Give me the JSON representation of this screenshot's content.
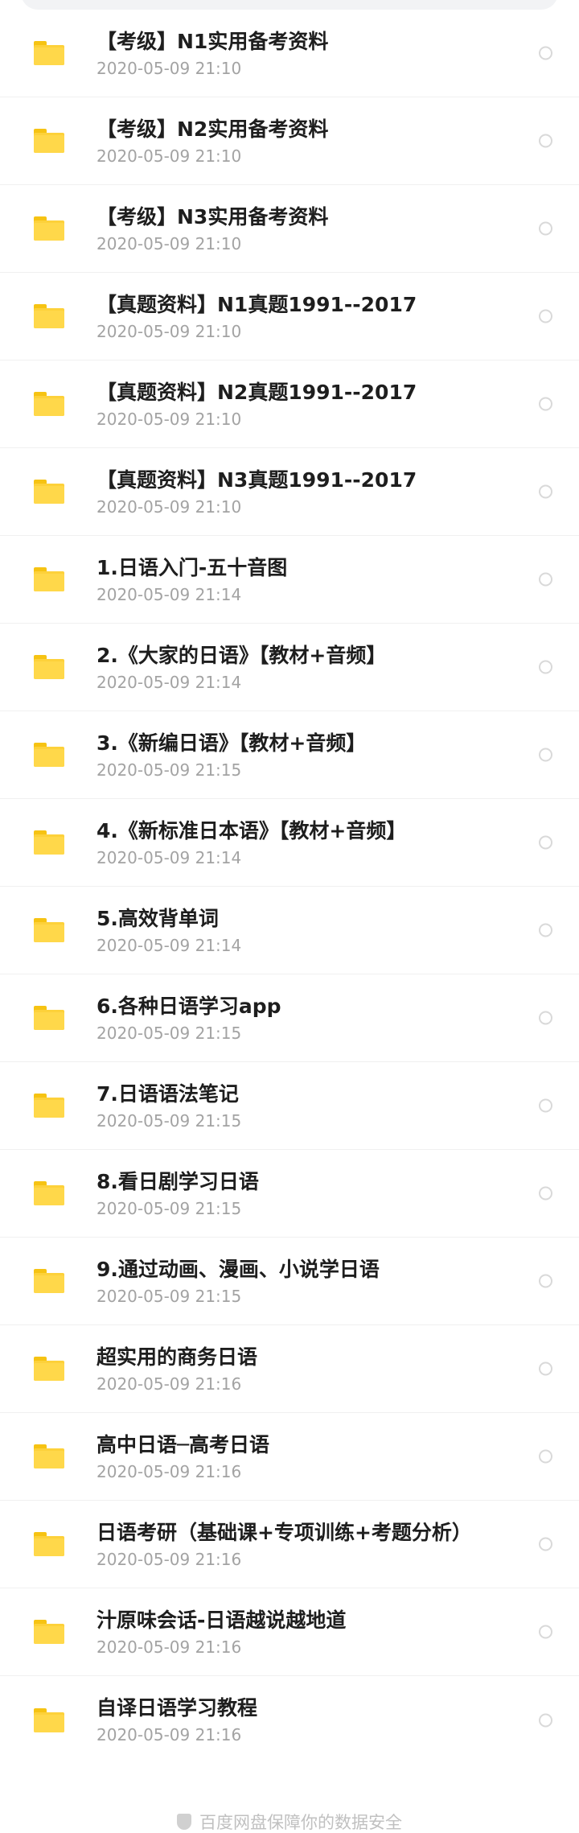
{
  "files": [
    {
      "name": "【考级】N1实用备考资料",
      "date": "2020-05-09  21:10"
    },
    {
      "name": "【考级】N2实用备考资料",
      "date": "2020-05-09  21:10"
    },
    {
      "name": "【考级】N3实用备考资料",
      "date": "2020-05-09  21:10"
    },
    {
      "name": "【真题资料】N1真题1991--2017",
      "date": "2020-05-09  21:10"
    },
    {
      "name": "【真题资料】N2真题1991--2017",
      "date": "2020-05-09  21:10"
    },
    {
      "name": "【真题资料】N3真题1991--2017",
      "date": "2020-05-09  21:10"
    },
    {
      "name": "1.日语入门-五十音图",
      "date": "2020-05-09  21:14"
    },
    {
      "name": "2.《大家的日语》【教材+音频】",
      "date": "2020-05-09  21:14"
    },
    {
      "name": "3.《新编日语》【教材+音频】",
      "date": "2020-05-09  21:15"
    },
    {
      "name": "4.《新标准日本语》【教材+音频】",
      "date": "2020-05-09  21:14"
    },
    {
      "name": "5.高效背单词",
      "date": "2020-05-09  21:14"
    },
    {
      "name": "6.各种日语学习app",
      "date": "2020-05-09  21:15"
    },
    {
      "name": "7.日语语法笔记",
      "date": "2020-05-09  21:15"
    },
    {
      "name": "8.看日剧学习日语",
      "date": "2020-05-09  21:15"
    },
    {
      "name": "9.通过动画、漫画、小说学日语",
      "date": "2020-05-09  21:15"
    },
    {
      "name": "超实用的商务日语",
      "date": "2020-05-09  21:16"
    },
    {
      "name": "高中日语─高考日语",
      "date": "2020-05-09  21:16"
    },
    {
      "name": "日语考研（基础课+专项训练+考题分析）",
      "date": "2020-05-09  21:16"
    },
    {
      "name": "汁原味会话-日语越说越地道",
      "date": "2020-05-09  21:16"
    },
    {
      "name": "自译日语学习教程",
      "date": "2020-05-09  21:16"
    }
  ],
  "footer": {
    "text": "百度网盘保障你的数据安全",
    "icon": "shield-icon"
  },
  "colors": {
    "folder": "#fdd13a",
    "title": "#1e1e1e",
    "date": "#a3a3a3"
  }
}
